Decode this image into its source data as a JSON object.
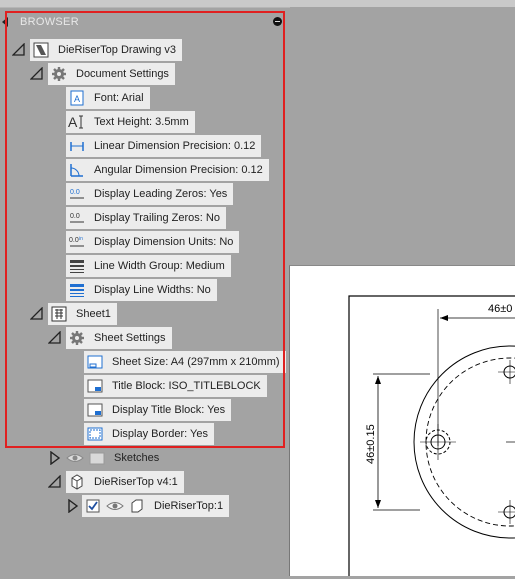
{
  "browser": {
    "title": "BROWSER"
  },
  "tree": {
    "root": "DieRiserTop Drawing v3",
    "document_settings": {
      "label": "Document Settings",
      "items": [
        {
          "label": "Font: Arial",
          "icon": "font-icon"
        },
        {
          "label": "Text Height: 3.5mm",
          "icon": "text-height-icon"
        },
        {
          "label": "Linear Dimension Precision: 0.12",
          "icon": "linear-dimension-icon"
        },
        {
          "label": "Angular Dimension Precision: 0.12",
          "icon": "angular-dimension-icon"
        },
        {
          "label": "Display Leading Zeros: Yes",
          "icon": "leading-zeros-icon"
        },
        {
          "label": "Display Trailing Zeros: No",
          "icon": "trailing-zeros-icon"
        },
        {
          "label": "Display Dimension Units: No",
          "icon": "dimension-units-icon"
        },
        {
          "label": "Line Width Group: Medium",
          "icon": "line-width-group-icon"
        },
        {
          "label": "Display Line Widths: No",
          "icon": "line-widths-icon"
        }
      ]
    },
    "sheet1": {
      "label": "Sheet1",
      "sheet_settings": {
        "label": "Sheet Settings",
        "items": [
          {
            "label": "Sheet Size: A4 (297mm x 210mm)",
            "icon": "sheet-size-icon"
          },
          {
            "label": "Title Block: ISO_TITLEBLOCK",
            "icon": "title-block-icon"
          },
          {
            "label": "Display Title Block: Yes",
            "icon": "display-title-block-icon"
          },
          {
            "label": "Display Border: Yes",
            "icon": "display-border-icon"
          }
        ]
      }
    },
    "sketches": "Sketches",
    "component": "DieRiserTop v4:1",
    "body": "DieRiserTop:1"
  },
  "drawing": {
    "dim_horizontal": "46±0",
    "dim_vertical": "46±0.15"
  },
  "colors": {
    "highlight_box": "#e02020",
    "accent_blue": "#1f6fd1"
  }
}
